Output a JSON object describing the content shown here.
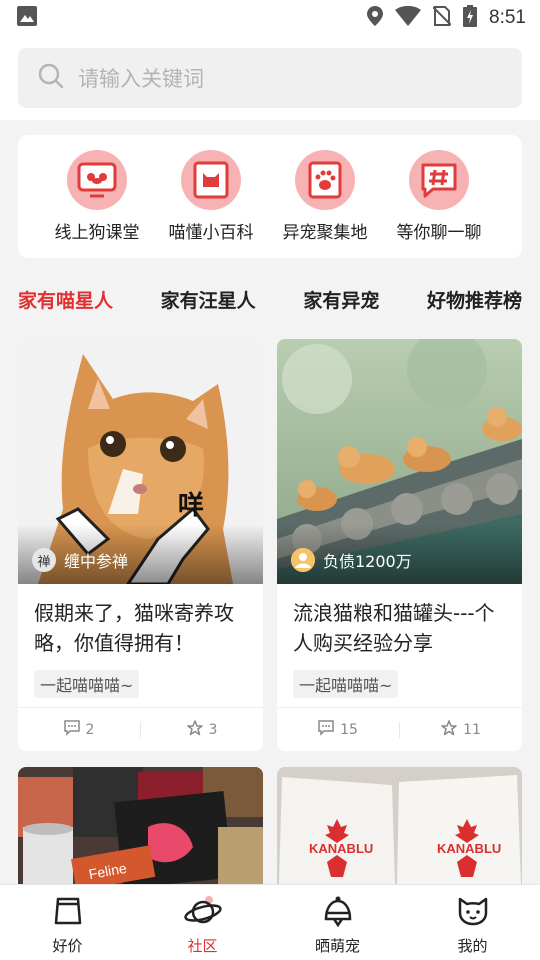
{
  "status_bar": {
    "time": "8:51"
  },
  "search": {
    "placeholder": "请输入关键词"
  },
  "categories": [
    {
      "label": "线上狗课堂",
      "icon": "dog-screen-icon"
    },
    {
      "label": "喵懂小百科",
      "icon": "cat-book-icon"
    },
    {
      "label": "异宠聚集地",
      "icon": "paw-card-icon"
    },
    {
      "label": "等你聊一聊",
      "icon": "hashtag-chat-icon"
    }
  ],
  "tabs": [
    {
      "label": "家有喵星人",
      "active": true
    },
    {
      "label": "家有汪星人",
      "active": false
    },
    {
      "label": "家有异宠",
      "active": false
    },
    {
      "label": "好物推荐榜",
      "active": false
    }
  ],
  "posts": [
    {
      "author": "缠中参禅",
      "title": "假期来了，猫咪寄养攻略，你值得拥有！",
      "tag": "一起喵喵喵~",
      "comments": "2",
      "favorites": "3",
      "image": "orange-cat-meme-photo"
    },
    {
      "author": "负债1200万",
      "title": "流浪猫粮和猫罐头---个人购买经验分享",
      "tag": "一起喵喵喵~",
      "comments": "15",
      "favorites": "11",
      "image": "cats-on-roof-photo"
    },
    {
      "image": "cat-food-packages-photo"
    },
    {
      "image": "kanablu-bags-photo"
    }
  ],
  "bottom_nav": [
    {
      "label": "好价",
      "active": false
    },
    {
      "label": "社区",
      "active": true
    },
    {
      "label": "晒萌宠",
      "active": false
    },
    {
      "label": "我的",
      "active": false
    }
  ],
  "colors": {
    "accent": "#e03131",
    "icon_bg": "#f7b3b3",
    "icon_fg": "#e23b3b"
  }
}
